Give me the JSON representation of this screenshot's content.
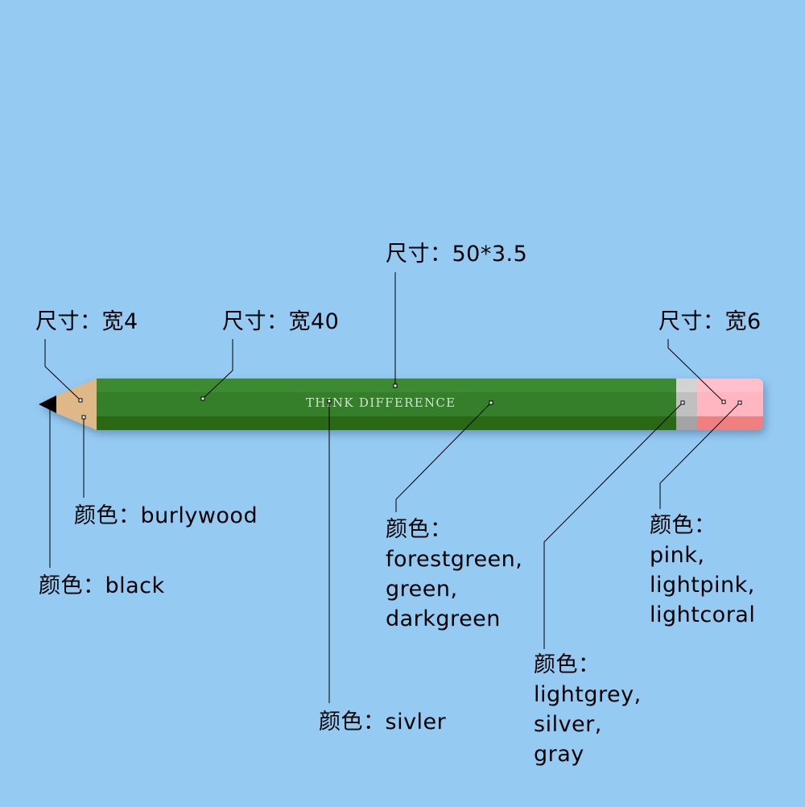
{
  "pencil": {
    "brand_text": "THINK DIFFERENCE"
  },
  "annotations": {
    "size_tip": "尺寸：宽4",
    "size_wood": "尺寸：宽40",
    "size_body": "尺寸：50*3.5",
    "size_eraser": "尺寸：宽6",
    "color_wood": "颜色：burlywood",
    "color_lead": "颜色：black",
    "color_body": "颜色：\nforestgreen,\ngreen,\ndarkgreen",
    "color_text": "颜色：sivler",
    "color_ferrule": "颜色：\nlightgrey,\nsilver,\ngray",
    "color_eraser": "颜色：\npink,\nlightpink,\nlightcoral"
  },
  "colors": {
    "background": "#95CAF3",
    "lead": "black",
    "wood": "burlywood",
    "body": [
      "forestgreen",
      "green",
      "darkgreen"
    ],
    "ferrule": [
      "lightgrey",
      "silver",
      "gray"
    ],
    "eraser": [
      "pink",
      "lightpink",
      "lightcoral"
    ],
    "text": "silver"
  }
}
